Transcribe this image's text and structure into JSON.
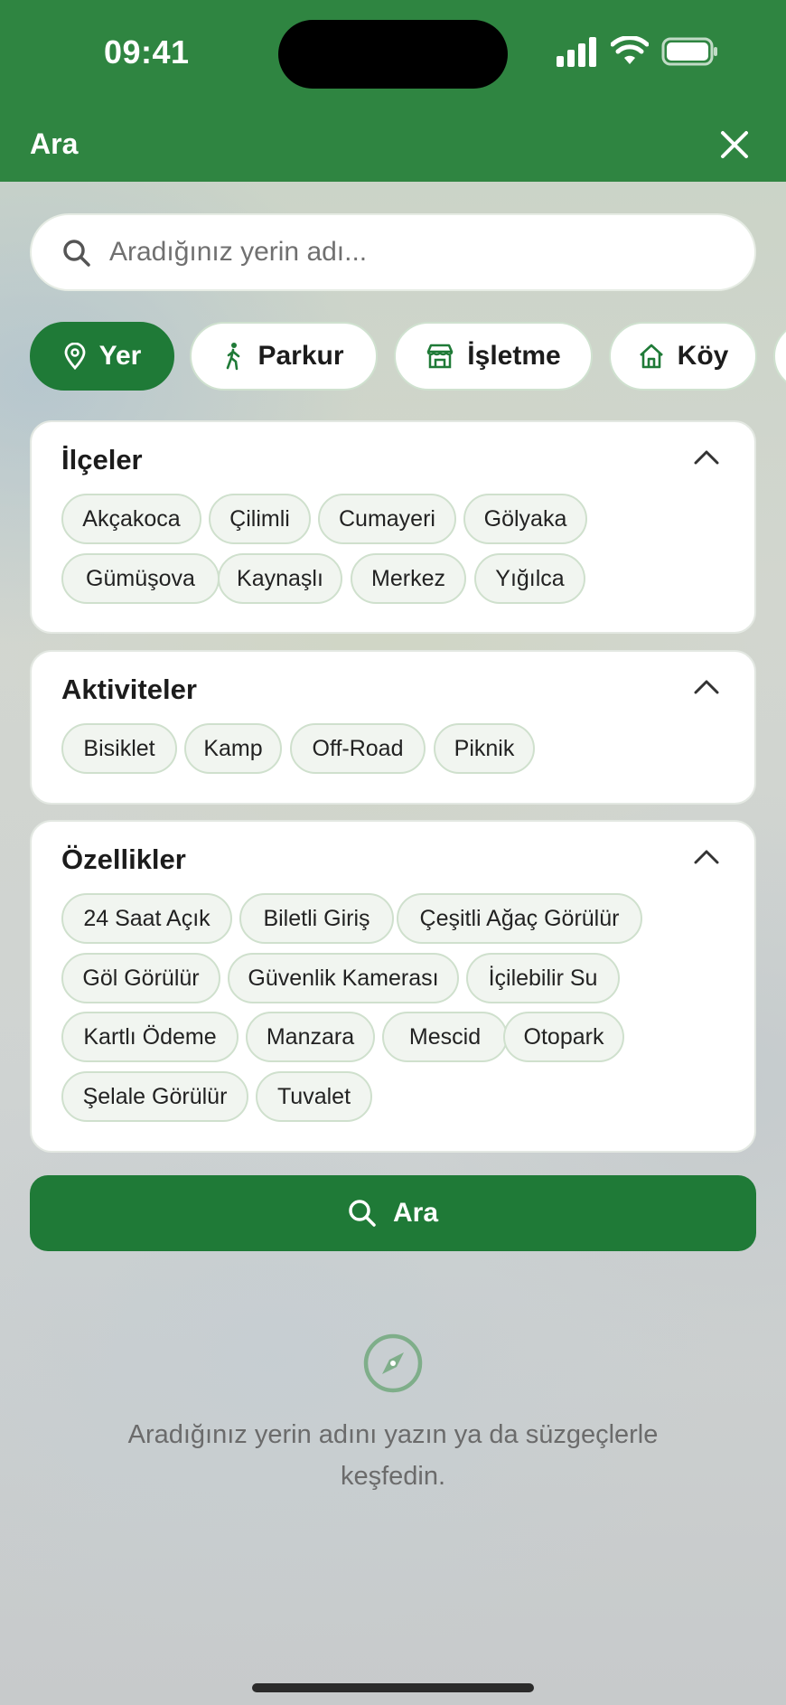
{
  "status_bar": {
    "time": "09:41"
  },
  "header": {
    "title": "Ara"
  },
  "search": {
    "placeholder": "Aradığınız yerin adı..."
  },
  "types": [
    {
      "label": "Yer",
      "icon": "location-pin-icon",
      "active": true
    },
    {
      "label": "Parkur",
      "icon": "hiker-icon",
      "active": false
    },
    {
      "label": "İşletme",
      "icon": "store-icon",
      "active": false
    },
    {
      "label": "Köy",
      "icon": "house-icon",
      "active": false
    }
  ],
  "sections": {
    "districts": {
      "title": "İlçeler",
      "tags": [
        "Akçakoca",
        "Çilimli",
        "Cumayeri",
        "Gölyaka",
        "Gümüşova",
        "Kaynaşlı",
        "Merkez",
        "Yığılca"
      ]
    },
    "activities": {
      "title": "Aktiviteler",
      "tags": [
        "Bisiklet",
        "Kamp",
        "Off-Road",
        "Piknik"
      ]
    },
    "features": {
      "title": "Özellikler",
      "tags": [
        "24 Saat Açık",
        "Biletli Giriş",
        "Çeşitli Ağaç Görülür",
        "Göl Görülür",
        "Güvenlik Kamerası",
        "İçilebilir Su",
        "Kartlı Ödeme",
        "Manzara",
        "Mescid",
        "Otopark",
        "Şelale Görülür",
        "Tuvalet"
      ]
    }
  },
  "search_button": {
    "label": "Ara"
  },
  "empty_state": {
    "message": "Aradığınız yerin adını yazın ya da süzgeçlerle keşfedin."
  },
  "colors": {
    "primary": "#2f8541",
    "button": "#1f7a37",
    "chip_border": "#cfe0cd",
    "chip_bg": "#f1f5f0"
  }
}
